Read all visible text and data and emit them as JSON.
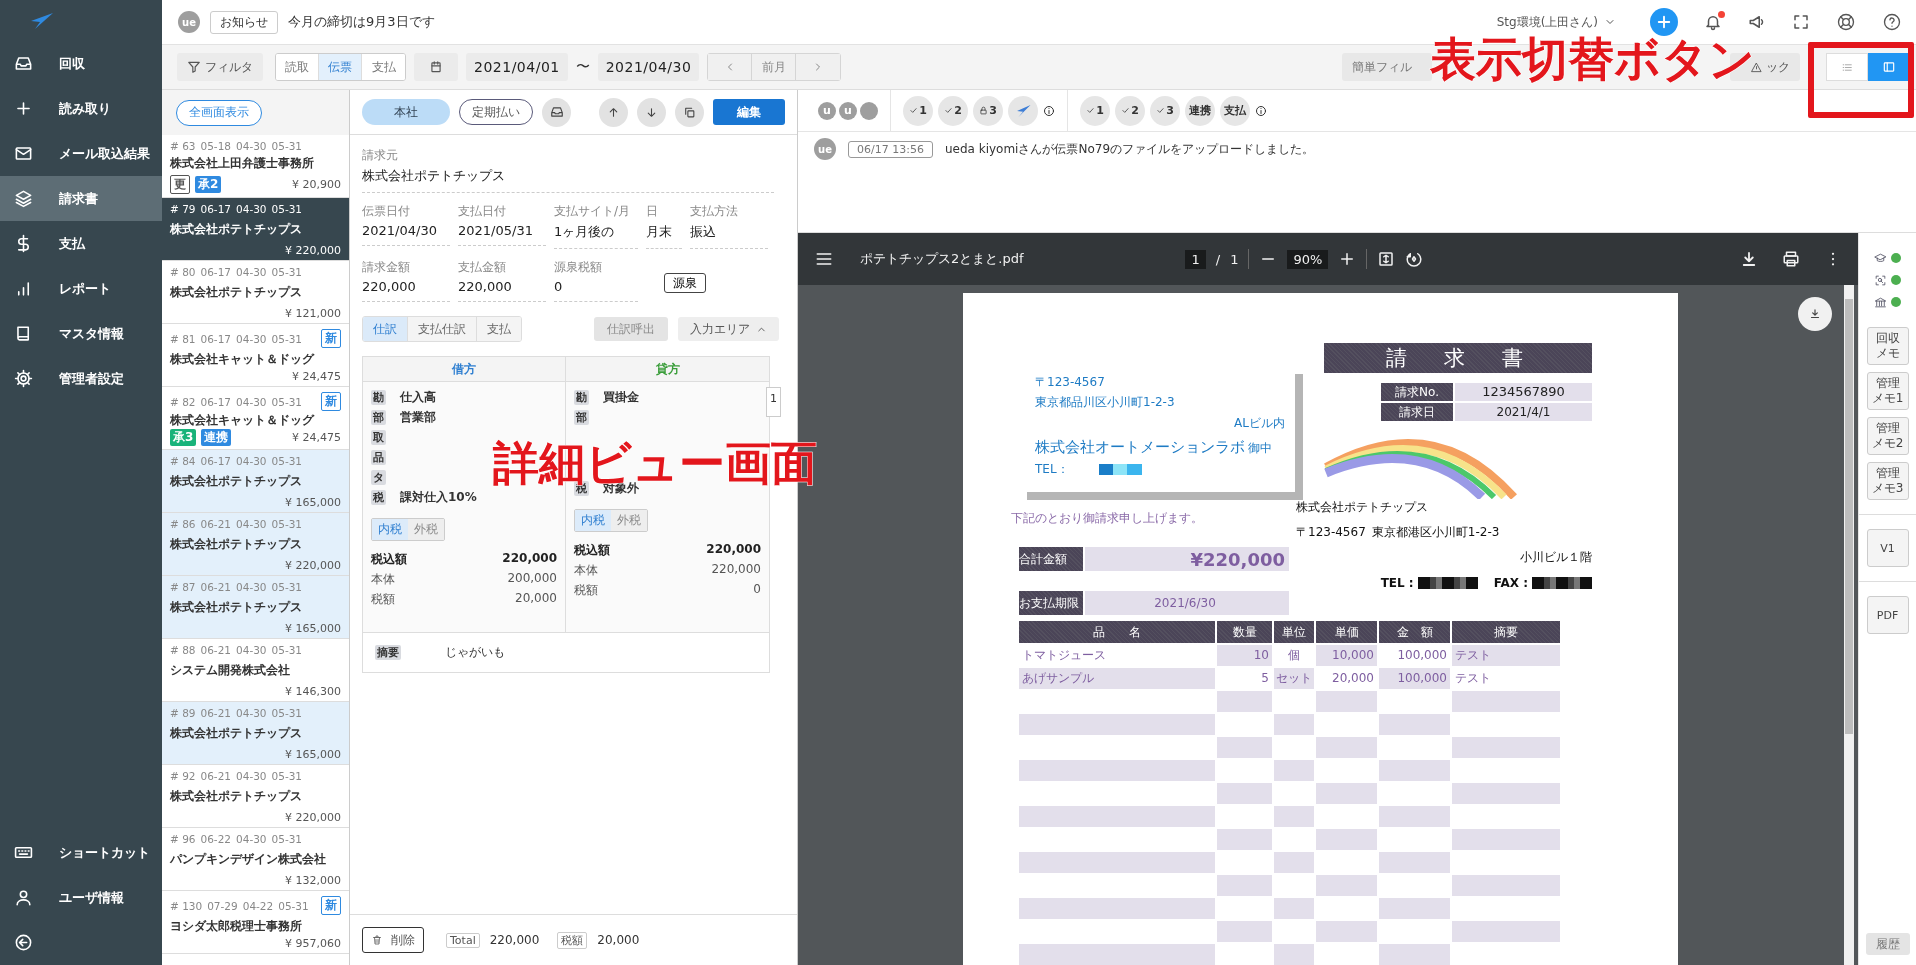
{
  "sidebar": {
    "items": [
      {
        "kind": "inbox",
        "label": "回収",
        "selected": false
      },
      {
        "kind": "plus",
        "label": "読み取り",
        "selected": false
      },
      {
        "kind": "mail",
        "label": "メール取込結果",
        "selected": false
      },
      {
        "kind": "layers",
        "label": "請求書",
        "selected": true
      },
      {
        "kind": "dollar",
        "label": "支払",
        "selected": false
      },
      {
        "kind": "bars",
        "label": "レポート",
        "selected": false
      },
      {
        "kind": "book",
        "label": "マスタ情報",
        "selected": false
      },
      {
        "kind": "gear",
        "label": "管理者設定",
        "selected": false
      }
    ],
    "bottom_items": [
      {
        "kind": "keyboard",
        "label": "ショートカット"
      },
      {
        "kind": "user",
        "label": "ユーザ情報"
      }
    ]
  },
  "topbar": {
    "avatar": "ue",
    "notice_label": "お知らせ",
    "notice": "今月の締切は9月3日です",
    "environment": "Stg環境(上田さん)",
    "has_unread": true
  },
  "filterbar": {
    "filter": "フィルタ",
    "segments": [
      {
        "label": "読取",
        "selected": false
      },
      {
        "label": "伝票",
        "selected": true
      },
      {
        "label": "支払",
        "selected": false
      }
    ],
    "date_from": "2021/04/01",
    "range_sep": "〜",
    "date_to": "2021/04/30",
    "prev_month": "前月",
    "quick_filter": "簡単フィル",
    "check": "ック",
    "views": [
      {
        "kind": "list",
        "selected": false
      },
      {
        "kind": "split",
        "selected": true
      }
    ]
  },
  "list": {
    "fullscreen": "全画面表示",
    "items": [
      {
        "number": "# 63",
        "dates": [
          "05-18",
          "04-30",
          "05-31"
        ],
        "company": "株式会社上田弁護士事務所",
        "amount": "¥ 20,900",
        "badges": [
          {
            "kind": "outline",
            "label": "更"
          },
          {
            "kind": "blue",
            "label": "承2"
          }
        ],
        "selected": false,
        "highlighted": false
      },
      {
        "number": "# 79",
        "dates": [
          "06-17",
          "04-30",
          "05-31"
        ],
        "company": "株式会社ポテトチップス",
        "amount": "¥ 220,000",
        "selected": true,
        "highlighted": false
      },
      {
        "number": "# 80",
        "dates": [
          "06-17",
          "04-30",
          "05-31"
        ],
        "company": "株式会社ポテトチップス",
        "amount": "¥ 121,000",
        "selected": false,
        "highlighted": false
      },
      {
        "number": "# 81",
        "dates": [
          "06-17",
          "04-30",
          "05-31"
        ],
        "new_badge": "新",
        "company": "株式会社キャット＆ドッグ",
        "amount": "¥ 24,475",
        "selected": false,
        "highlighted": false
      },
      {
        "number": "# 82",
        "dates": [
          "06-17",
          "04-30",
          "05-31"
        ],
        "new_badge": "新",
        "company": "株式会社キャット＆ドッグ",
        "amount": "¥ 24,475",
        "badges": [
          {
            "kind": "green",
            "label": "承3"
          },
          {
            "kind": "blue",
            "label": "連携"
          }
        ],
        "selected": false,
        "highlighted": false
      },
      {
        "number": "# 84",
        "dates": [
          "06-17",
          "04-30",
          "05-31"
        ],
        "company": "株式会社ポテトチップス",
        "amount": "¥ 165,000",
        "selected": false,
        "highlighted": true
      },
      {
        "number": "# 86",
        "dates": [
          "06-21",
          "04-30",
          "05-31"
        ],
        "company": "株式会社ポテトチップス",
        "amount": "¥ 220,000",
        "selected": false,
        "highlighted": true
      },
      {
        "number": "# 87",
        "dates": [
          "06-21",
          "04-30",
          "05-31"
        ],
        "company": "株式会社ポテトチップス",
        "amount": "¥ 165,000",
        "selected": false,
        "highlighted": true
      },
      {
        "number": "# 88",
        "dates": [
          "06-21",
          "04-30",
          "05-31"
        ],
        "company": "システム開発株式会社",
        "amount": "¥ 146,300",
        "selected": false,
        "highlighted": false
      },
      {
        "number": "# 89",
        "dates": [
          "06-21",
          "04-30",
          "05-31"
        ],
        "company": "株式会社ポテトチップス",
        "amount": "¥ 165,000",
        "selected": false,
        "highlighted": true
      },
      {
        "number": "# 92",
        "dates": [
          "06-21",
          "04-30",
          "05-31"
        ],
        "company": "株式会社ポテトチップス",
        "amount": "¥ 220,000",
        "selected": false,
        "highlighted": false
      },
      {
        "number": "# 96",
        "dates": [
          "06-22",
          "04-30",
          "05-31"
        ],
        "company": "パンプキンデザイン株式会社",
        "amount": "¥ 132,000",
        "selected": false,
        "highlighted": false
      },
      {
        "number": "# 130",
        "dates": [
          "07-29",
          "04-22",
          "05-31"
        ],
        "new_badge": "新",
        "company": "ヨシダ太郎税理士事務所",
        "amount": "¥ 957,060",
        "selected": false,
        "highlighted": false
      }
    ]
  },
  "detail": {
    "branch": "本社",
    "recurring": "定期払い",
    "edit": "編集",
    "issuer": {
      "label": "請求元",
      "value": "株式会社ポテトチップス"
    },
    "field_rows": [
      [
        {
          "label": "伝票日付",
          "value": "2021/04/30"
        },
        {
          "label": "支払日付",
          "value": "2021/05/31"
        },
        {
          "label": "支払サイト/月",
          "value": "1ヶ月後の"
        },
        {
          "label": "日",
          "value": "月末"
        },
        {
          "label": "支払方法",
          "value": "振込"
        }
      ],
      [
        {
          "label": "請求金額",
          "value": "220,000"
        },
        {
          "label": "支払金額",
          "value": "220,000"
        },
        {
          "label": "源泉税額",
          "value": "0"
        }
      ]
    ],
    "withholding": "源泉",
    "tabs": [
      {
        "label": "仕訳",
        "selected": true
      },
      {
        "label": "支払仕訳",
        "selected": false
      },
      {
        "label": "支払",
        "selected": false
      }
    ],
    "call_journal": {
      "label": "仕訳呼出",
      "disabled": true
    },
    "input_area": "入力エリア",
    "journal": {
      "sides": [
        {
          "kind": "debit",
          "title": "借方",
          "rows": [
            {
              "tag": "勘",
              "value": "仕入高"
            },
            {
              "tag": "部",
              "value": "営業部"
            },
            {
              "tag": "取"
            },
            {
              "tag": "品"
            },
            {
              "tag": "タ"
            },
            {
              "tag": "税",
              "value": "課対仕入10%"
            }
          ],
          "tax_modes": [
            {
              "label": "内税",
              "selected": true
            },
            {
              "label": "外税",
              "selected": false
            }
          ],
          "totals": [
            {
              "label": "税込額",
              "value": "220,000",
              "bold": true
            },
            {
              "label": "本体",
              "value": "200,000",
              "bold": false
            },
            {
              "label": "税額",
              "value": "20,000",
              "bold": false
            }
          ]
        },
        {
          "kind": "credit",
          "title": "貸方",
          "rows": [
            {
              "tag": "勘",
              "value": "買掛金"
            },
            {
              "tag": "部"
            },
            {
              "tag": "税",
              "value": "対象外"
            }
          ],
          "tax_modes": [
            {
              "label": "内税",
              "selected": true
            },
            {
              "label": "外税",
              "selected": false
            }
          ],
          "totals": [
            {
              "label": "税込額",
              "value": "220,000",
              "bold": true
            },
            {
              "label": "本体",
              "value": "220,000",
              "bold": false
            },
            {
              "label": "税額",
              "value": "0",
              "bold": false
            }
          ]
        }
      ],
      "pager": "1",
      "memo": {
        "tag": "摘要",
        "value": "じゃがいも"
      }
    },
    "footer": {
      "delete": "削除",
      "total_tag": "Total",
      "total": "220,000",
      "tax_tag": "税額",
      "tax": "20,000"
    }
  },
  "approvals": {
    "avatars": [
      {
        "kind": "initial",
        "label": "u"
      },
      {
        "kind": "initial",
        "label": "u"
      },
      {
        "kind": "blank"
      }
    ],
    "groups": [
      [
        {
          "kind": "check",
          "label": "1"
        },
        {
          "kind": "check",
          "label": "2"
        },
        {
          "kind": "lock",
          "label": "3"
        },
        {
          "kind": "logo"
        }
      ],
      [
        {
          "kind": "check",
          "label": "1"
        },
        {
          "kind": "check",
          "label": "2"
        },
        {
          "kind": "check",
          "label": "3"
        },
        {
          "kind": "text",
          "label": "連携"
        },
        {
          "kind": "text",
          "label": "支払"
        }
      ]
    ]
  },
  "log": [
    {
      "avatar": "ue",
      "time": "06/17 13:56",
      "message": "ueda kiyomiさんが伝票No79のファイルをアップロードしました。"
    }
  ],
  "pdf": {
    "file": "ポテトチップス2とまと.pdf",
    "page": "1",
    "sep": "/",
    "pages": "1",
    "zoom": "90%"
  },
  "invoice": {
    "title": "請　求　書",
    "to": {
      "zip": "〒123-4567",
      "address": "東京都品川区小川町1-2-3",
      "building": "ALビル内",
      "company": "株式会社オートメーションラボ",
      "honorific": "御中",
      "tel_label": "TEL："
    },
    "message": "下記のとおり御請求申し上げます。",
    "meta": [
      {
        "label": "請求No.",
        "value": "1234567890"
      },
      {
        "label": "請求日",
        "value": "2021/4/1"
      }
    ],
    "from": {
      "company": "株式会社ポテトチップス",
      "zip": "〒123-4567",
      "address": "東京都港区小川町1-2-3",
      "building": "小川ビル１階",
      "tel_label": "TEL :",
      "fax_label": "FAX :"
    },
    "total_label": "合計金額",
    "total": "¥220,000",
    "due_label": "お支払期限",
    "due": "2021/6/30",
    "columns": [
      "品　　名",
      "数量",
      "単位",
      "単価",
      "金　額",
      "摘要"
    ],
    "rows": [
      [
        "トマトジュース",
        "10",
        "個",
        "10,000",
        "100,000",
        "テスト"
      ],
      [
        "あげサンプル",
        "5",
        "セット",
        "20,000",
        "100,000",
        "テスト"
      ]
    ]
  },
  "side_panel": {
    "memos": [
      [
        "回収",
        "メモ"
      ],
      [
        "管理",
        "メモ1"
      ],
      [
        "管理",
        "メモ2"
      ],
      [
        "管理",
        "メモ3"
      ]
    ],
    "version": "V1",
    "pdf": "PDF",
    "history": "履歴"
  },
  "annotations": [
    {
      "kind": "box"
    },
    {
      "kind": "label",
      "text": "表示切替ボタン"
    },
    {
      "kind": "label",
      "text": "詳細ビュー画面"
    }
  ]
}
